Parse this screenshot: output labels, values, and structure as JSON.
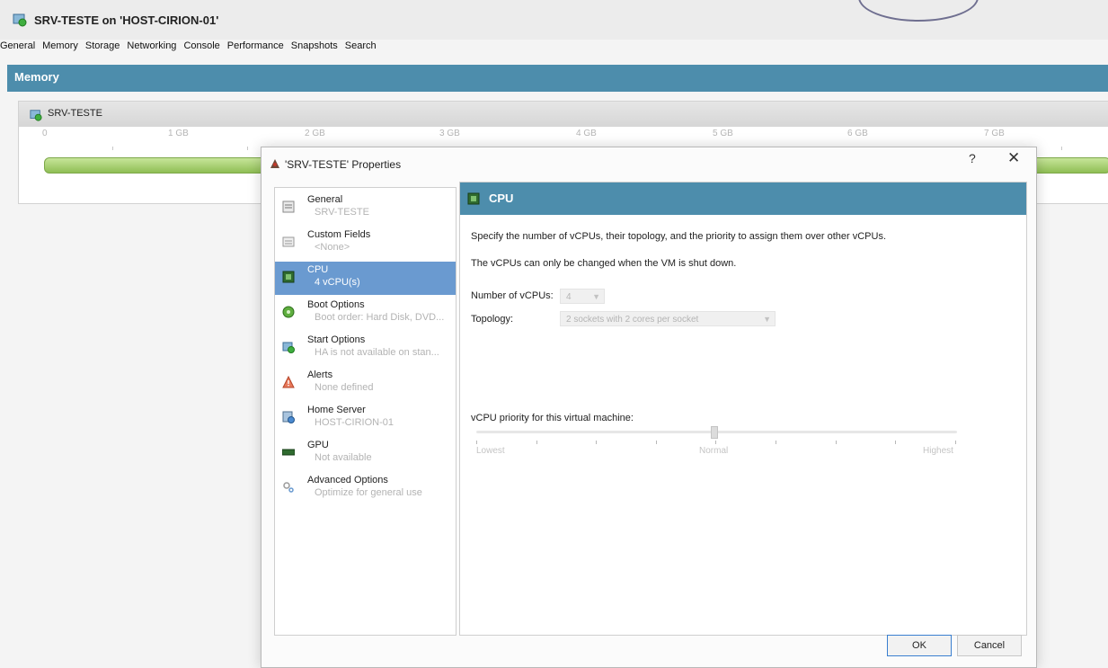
{
  "window": {
    "title": "SRV-TESTE on 'HOST-CIRION-01'"
  },
  "tabs": [
    "General",
    "Memory",
    "Storage",
    "Networking",
    "Console",
    "Performance",
    "Snapshots",
    "Search"
  ],
  "memory": {
    "header": "Memory",
    "vm_name": "SRV-TESTE",
    "scale_labels": [
      "0",
      "1 GB",
      "2 GB",
      "3 GB",
      "4 GB",
      "5 GB",
      "6 GB",
      "7 GB"
    ],
    "bar_color": "#8fbe55"
  },
  "dialog": {
    "title": "'SRV-TESTE' Properties",
    "help": "?",
    "close": "✕",
    "nav": [
      {
        "label": "General",
        "sub": "SRV-TESTE",
        "icon": "general-icon"
      },
      {
        "label": "Custom Fields",
        "sub": "<None>",
        "icon": "custom-fields-icon"
      },
      {
        "label": "CPU",
        "sub": "4 vCPU(s)",
        "icon": "cpu-icon",
        "selected": true
      },
      {
        "label": "Boot Options",
        "sub": "Boot order: Hard Disk, DVD...",
        "icon": "boot-icon"
      },
      {
        "label": "Start Options",
        "sub": "HA is not available on stan...",
        "icon": "start-icon"
      },
      {
        "label": "Alerts",
        "sub": "None defined",
        "icon": "alert-icon"
      },
      {
        "label": "Home Server",
        "sub": "HOST-CIRION-01",
        "icon": "home-server-icon"
      },
      {
        "label": "GPU",
        "sub": "Not available",
        "icon": "gpu-icon"
      },
      {
        "label": "Advanced Options",
        "sub": "Optimize for general use",
        "icon": "advanced-icon"
      }
    ],
    "content": {
      "header": "CPU",
      "desc1": "Specify the number of vCPUs, their topology, and the priority to assign them over other vCPUs.",
      "desc2": "The vCPUs can only be changed when the VM is shut down.",
      "vcpus_label": "Number of vCPUs:",
      "vcpus_value": "4",
      "topology_label": "Topology:",
      "topology_value": "2 sockets with 2 cores per socket",
      "priority_label": "vCPU priority for this virtual machine:",
      "slider_labels": {
        "low": "Lowest",
        "mid": "Normal",
        "high": "Highest"
      },
      "slider_level": 0.5
    },
    "ok": "OK",
    "cancel": "Cancel"
  }
}
